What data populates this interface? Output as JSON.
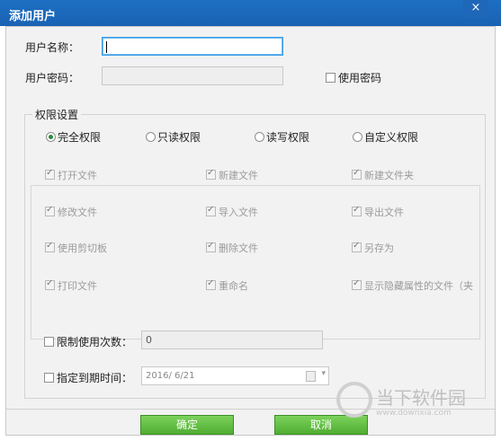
{
  "window": {
    "title": "添加用户",
    "close_glyph": "×"
  },
  "form": {
    "username_label": "用户名称：",
    "username_value": "",
    "password_label": "用户密码：",
    "password_value": "",
    "use_password_label": "使用密码"
  },
  "permissions": {
    "group_title": "权限设置",
    "modes": [
      {
        "label": "完全权限",
        "selected": true
      },
      {
        "label": "只读权限",
        "selected": false
      },
      {
        "label": "读写权限",
        "selected": false
      },
      {
        "label": "自定义权限",
        "selected": false
      }
    ],
    "items": [
      "打开文件",
      "新建文件",
      "新建文件夹",
      "修改文件",
      "导入文件",
      "导出文件",
      "使用剪切板",
      "删除文件",
      "另存为",
      "打印文件",
      "重命名",
      "显示隐藏属性的文件（夹"
    ]
  },
  "limits": {
    "usage_count_label": "限制使用次数：",
    "usage_count_value": "0",
    "expiry_label": "指定到期时间：",
    "expiry_value": "2016/  6/21"
  },
  "buttons": {
    "ok": "确定",
    "cancel": "取消"
  },
  "watermark": {
    "text": "当下软件园",
    "url": "www.downxia.com"
  },
  "colors": {
    "titlebar": "#1a62b4",
    "button_green": "#4fae32",
    "radio_dot": "#2a8a3a"
  }
}
